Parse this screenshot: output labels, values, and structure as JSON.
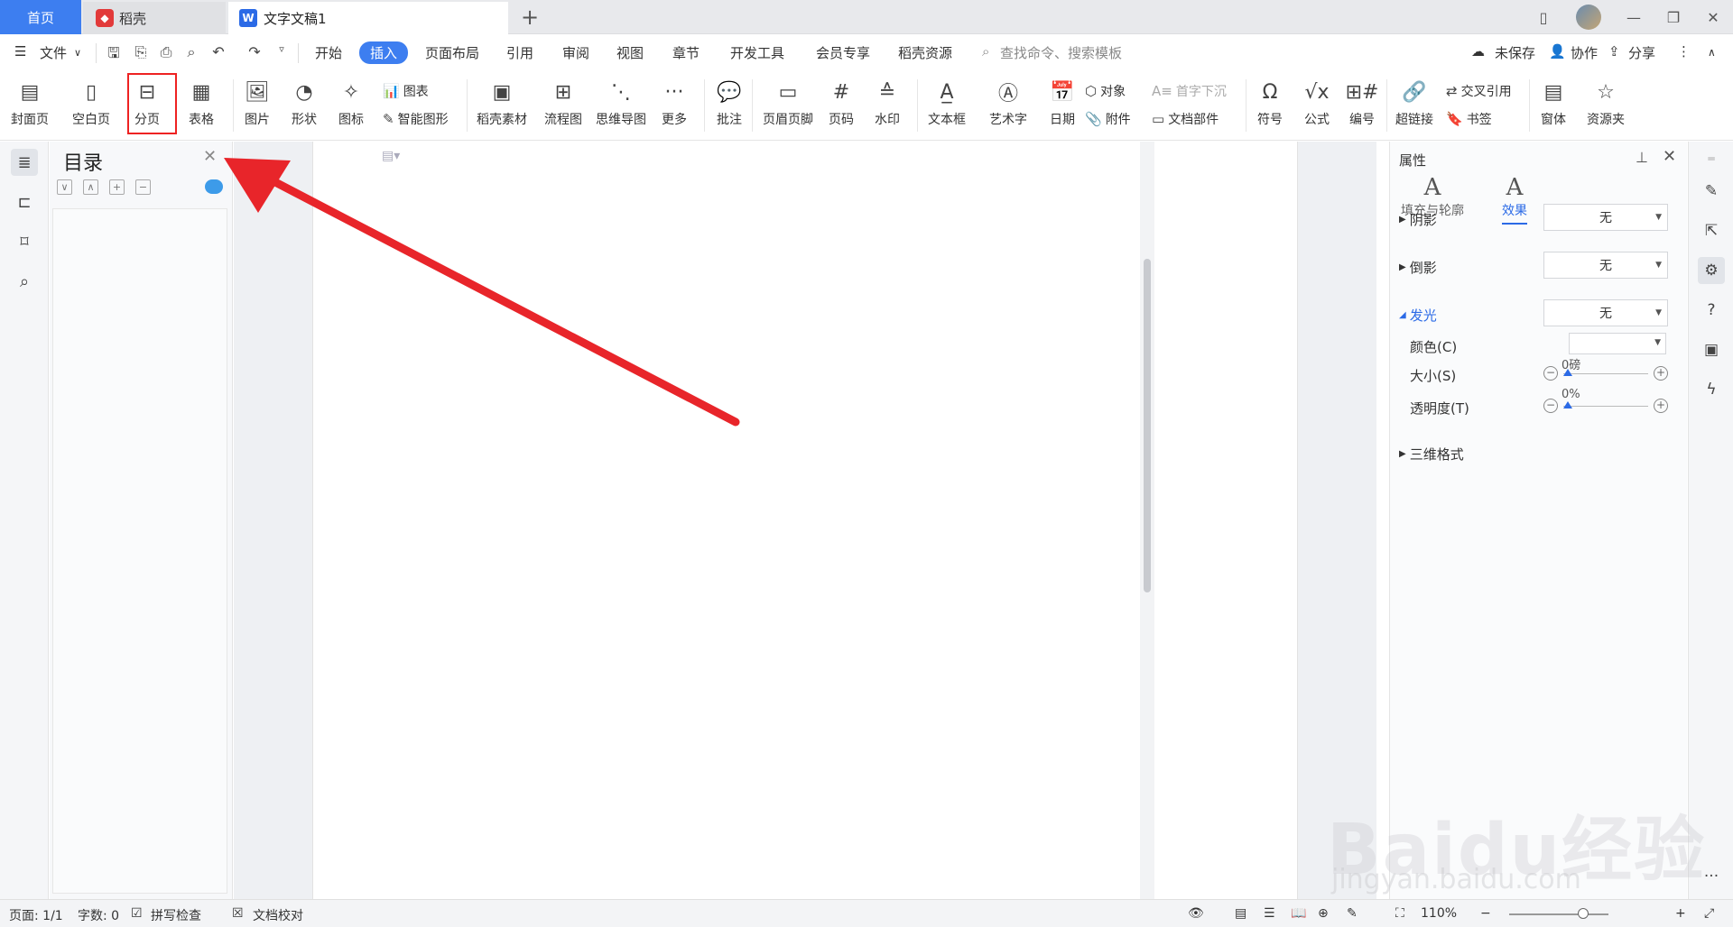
{
  "titlebar": {
    "home_tab": "首页",
    "daoke_tab": "稻壳",
    "doc_tab": "文字文稿1"
  },
  "menubar": {
    "file": "文件",
    "tabs": [
      "开始",
      "插入",
      "页面布局",
      "引用",
      "审阅",
      "视图",
      "章节",
      "开发工具",
      "会员专享",
      "稻壳资源"
    ],
    "active_tab": "插入",
    "search_placeholder": "查找命令、搜索模板",
    "unsaved": "未保存",
    "collab": "协作",
    "share": "分享"
  },
  "ribbon": {
    "cover_page": "封面页",
    "blank_page": "空白页",
    "page_break": "分页",
    "table": "表格",
    "picture": "图片",
    "shape": "形状",
    "icon": "图标",
    "chart": "图表",
    "smart_art": "智能图形",
    "daoke_material": "稻壳素材",
    "flowchart": "流程图",
    "mindmap": "思维导图",
    "more": "更多",
    "comment": "批注",
    "header_footer": "页眉页脚",
    "page_number": "页码",
    "watermark": "水印",
    "textbox": "文本框",
    "wordart": "艺术字",
    "date": "日期",
    "object": "对象",
    "attachment": "附件",
    "drop_cap": "首字下沉",
    "doc_parts": "文档部件",
    "symbol": "符号",
    "formula": "公式",
    "numbering": "编号",
    "hyperlink": "超链接",
    "cross_ref": "交叉引用",
    "bookmark": "书签",
    "window": "窗体",
    "resource_folder": "资源夹"
  },
  "toc": {
    "title": "目录"
  },
  "props": {
    "title": "属性",
    "tab_fill": "填充与轮廓",
    "tab_effect": "效果",
    "shadow": "阴影",
    "shadow_val": "无",
    "reflection": "倒影",
    "reflection_val": "无",
    "glow": "发光",
    "glow_val": "无",
    "color_label": "颜色(C)",
    "size_label": "大小(S)",
    "size_val": "0磅",
    "transparency_label": "透明度(T)",
    "transparency_val": "0%",
    "three_d": "三维格式"
  },
  "status": {
    "page": "页面: 1/1",
    "words": "字数: 0",
    "spell": "拼写检查",
    "proof": "文档校对",
    "zoom": "110%"
  },
  "watermark": {
    "logo": "Baidu经验",
    "url": "jingyan.baidu.com"
  },
  "colors": {
    "accent": "#3d7ef0",
    "highlight_box": "#e22222",
    "arrow": "#e8252a"
  }
}
